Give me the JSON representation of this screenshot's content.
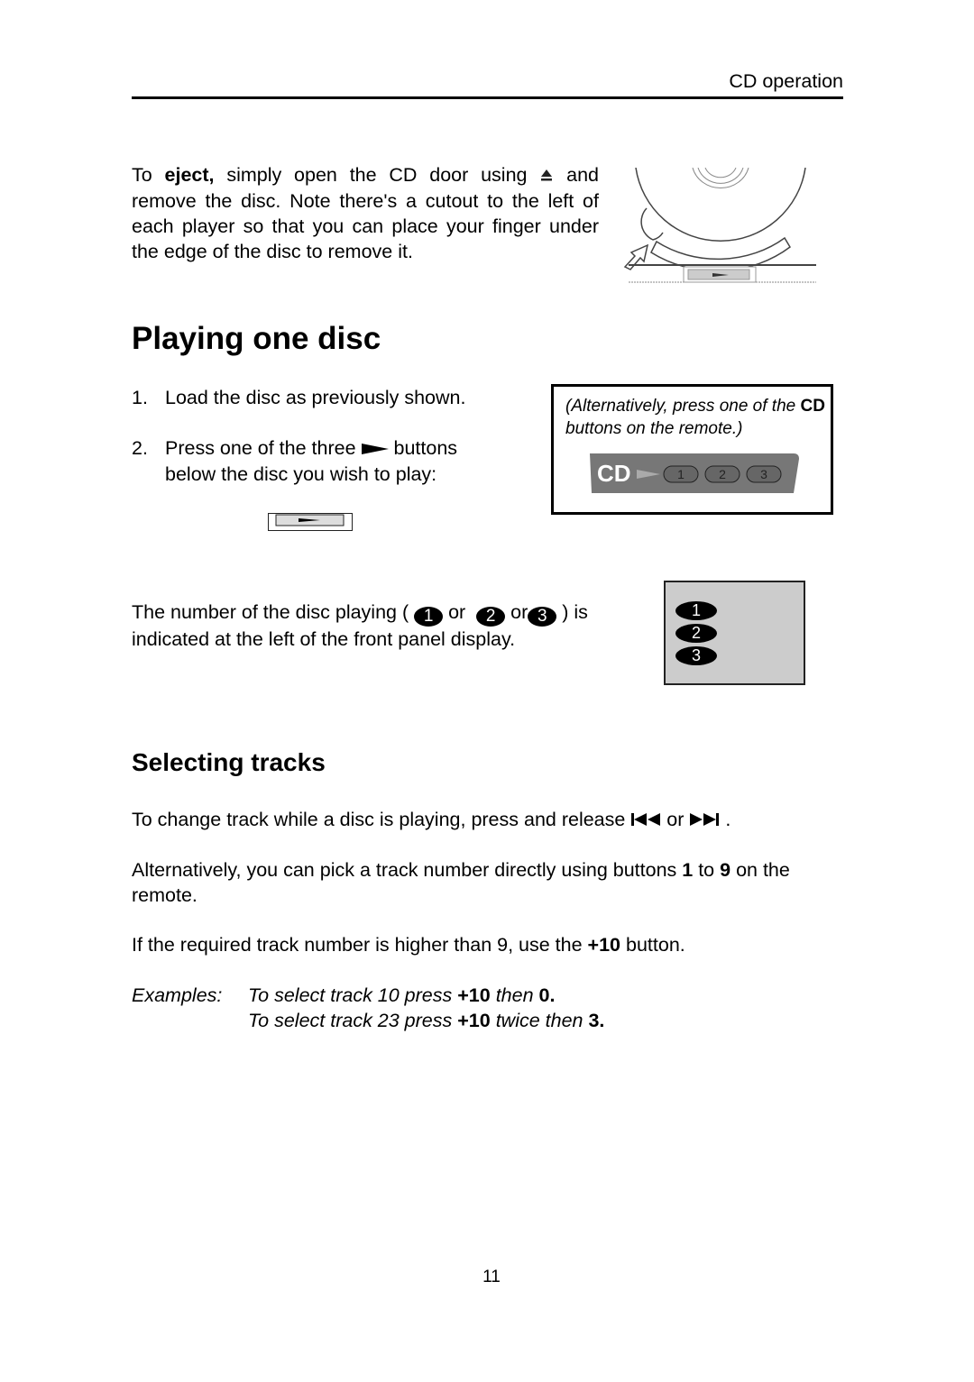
{
  "header": {
    "section_title": "CD operation"
  },
  "eject": {
    "prefix": "To ",
    "bold_word": "eject,",
    "text_before_icon": " simply open the CD door using ",
    "eject_icon": "eject-icon",
    "text_after_icon": " and remove the disc. Note there's a cutout to the left of each player so that you can place your finger under the edge of the disc to remove it.",
    "figure": "cd-tray-eject-illustration"
  },
  "playing_one_disc": {
    "heading": "Playing one disc",
    "steps": [
      {
        "num": "1.",
        "text": "Load the disc as previously shown."
      },
      {
        "num": "2.",
        "text_before_icon": "Press one of the three ",
        "play_icon": "play-icon",
        "text_after_icon": " buttons below the disc you wish to play:"
      }
    ],
    "play_button_figure": "play-button-illustration",
    "remote_note": {
      "line_start": "(Alternatively, press one of the ",
      "bold": "CD",
      "line_end": " buttons on the remote.)"
    },
    "remote_buttons": {
      "label": "CD",
      "buttons": [
        "1",
        "2",
        "3"
      ]
    },
    "indicator": {
      "text_start": "The number of the disc playing ( ",
      "badges": [
        "1",
        "2",
        "3"
      ],
      "or": "or",
      "text_end": ") is indicated at the left of the front panel display."
    },
    "display_panel": {
      "badges": [
        "1",
        "2",
        "3"
      ]
    }
  },
  "selecting_tracks": {
    "heading": "Selecting tracks",
    "para1_start": "To change track while a disc is playing, press and release ",
    "prev_icon": "skip-previous-icon",
    "para1_or": " or ",
    "next_icon": "skip-next-icon",
    "para1_end": " .",
    "para2_start": "Alternatively, you can pick a track number directly using buttons ",
    "para2_b1": "1",
    "para2_mid": " to ",
    "para2_b2": "9",
    "para2_end": " on the remote.",
    "para3_start": "If the required track number is higher than 9, use the ",
    "para3_bold": "+10",
    "para3_end": " button.",
    "examples_label": "Examples:",
    "example1": {
      "a": "To select track 10 press ",
      "b": "+10",
      "c": " then ",
      "d": "0."
    },
    "example2": {
      "a": "To select track 23 press ",
      "b": "+10",
      "c": " twice then ",
      "d": "3."
    }
  },
  "footer": {
    "page_number": "11"
  }
}
